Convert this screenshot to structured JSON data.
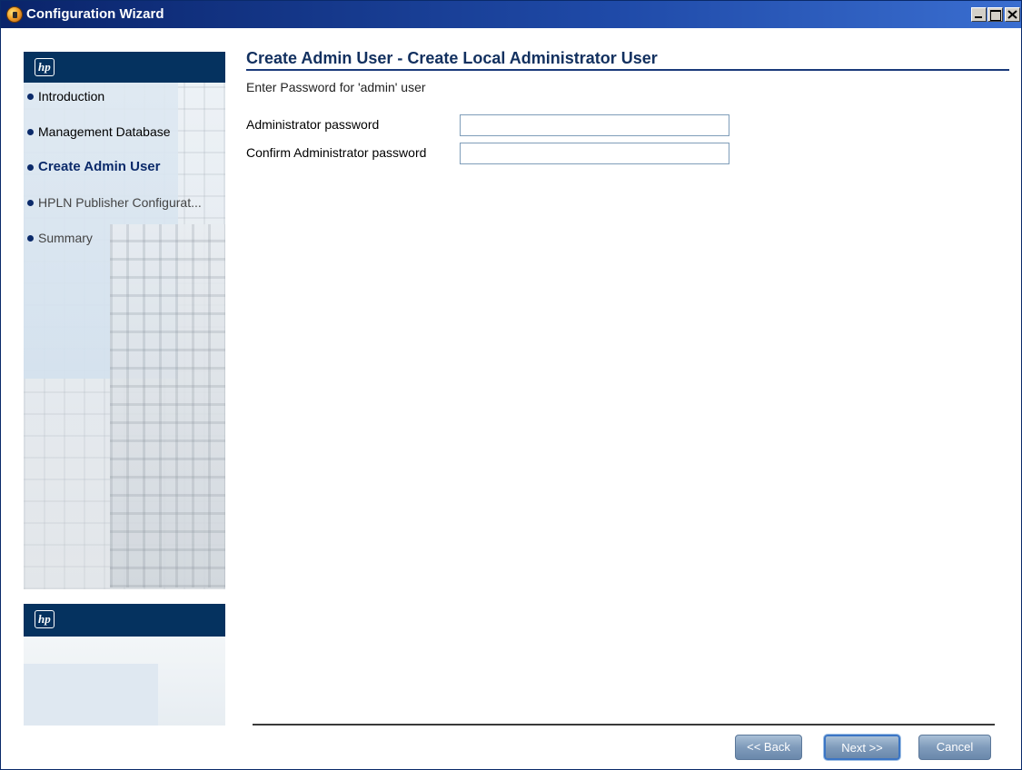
{
  "window": {
    "title": "Configuration Wizard"
  },
  "sidebar": {
    "logo_text": "hp",
    "items": [
      {
        "label": "Introduction",
        "state": "done"
      },
      {
        "label": "Management Database",
        "state": "done"
      },
      {
        "label": "Create Admin User",
        "state": "active"
      },
      {
        "label": "HPLN Publisher Configurat...",
        "state": "pending"
      },
      {
        "label": "Summary",
        "state": "pending"
      }
    ]
  },
  "main": {
    "title": "Create Admin User - Create Local Administrator User",
    "subtitle": "Enter Password for 'admin' user",
    "fields": [
      {
        "label": "Administrator password",
        "value": ""
      },
      {
        "label": "Confirm Administrator password",
        "value": ""
      }
    ]
  },
  "buttons": {
    "back": "<< Back",
    "next": "Next >>",
    "cancel": "Cancel"
  },
  "colors": {
    "titlebar": "#0a246a",
    "sidebar_header": "#05325f",
    "accent": "#12305f",
    "button": "#7f9bbb"
  }
}
